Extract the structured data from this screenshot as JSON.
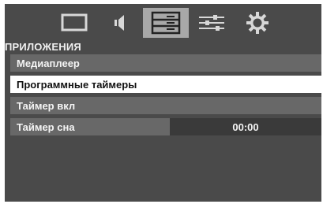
{
  "tabs": [
    {
      "icon": "picture-icon",
      "active": false
    },
    {
      "icon": "sound-icon",
      "active": false
    },
    {
      "icon": "applications-icon",
      "active": true
    },
    {
      "icon": "adjustments-icon",
      "active": false
    },
    {
      "icon": "settings-gear-icon",
      "active": false
    }
  ],
  "section": {
    "title": "ПРИЛОЖЕНИЯ"
  },
  "menu": {
    "items": [
      {
        "label": "Медиаплеер"
      },
      {
        "label": "Программные таймеры"
      },
      {
        "label": "Таймер вкл"
      },
      {
        "label": "Таймер сна",
        "value": "00:00"
      }
    ],
    "selected_index": 1
  },
  "colors": {
    "background": "#4a4a4a",
    "row": "#686868",
    "selected_row": "#ffffff",
    "active_tab": "#a8a8a8",
    "value_box": "#3a3a3a"
  }
}
